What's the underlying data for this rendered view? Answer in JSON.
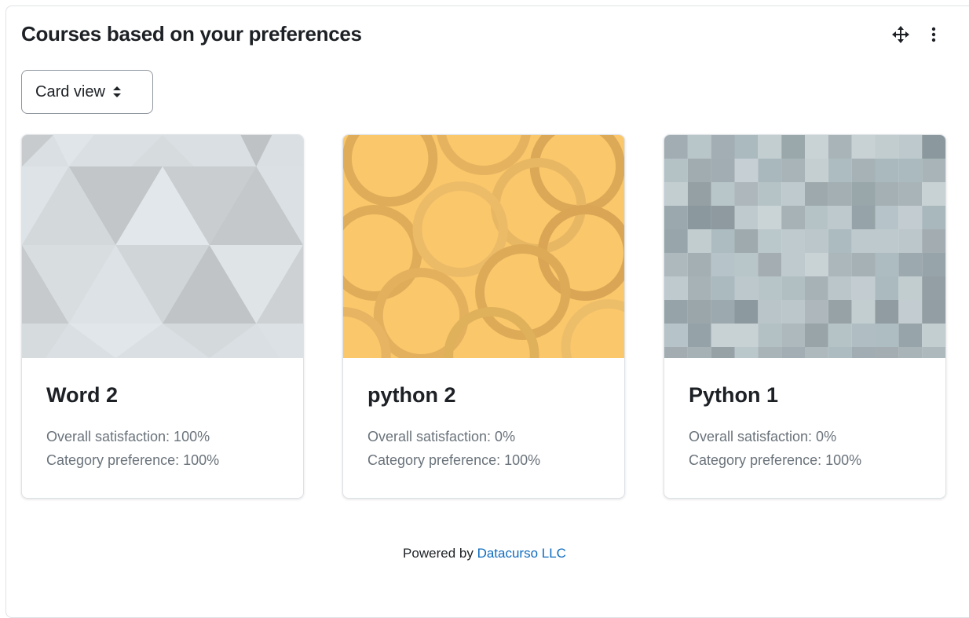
{
  "block": {
    "title": "Courses based on your preferences"
  },
  "controls": {
    "move_icon": "move-arrows-icon",
    "menu_icon": "vertical-ellipsis-icon"
  },
  "view_select": {
    "selected": "Card view"
  },
  "courses": [
    {
      "title": "Word 2",
      "satisfaction": "Overall satisfaction: 100%",
      "preference": "Category preference: 100%",
      "pattern": "triangles",
      "colors": [
        "#dfe5e8",
        "#c9cdd0",
        "#bec2c5",
        "#d4d9dc"
      ]
    },
    {
      "title": "python 2",
      "satisfaction": "Overall satisfaction: 0%",
      "preference": "Category preference: 100%",
      "pattern": "circles",
      "colors": [
        "#fbc76b",
        "#d8a85a",
        "#e6b463"
      ]
    },
    {
      "title": "Python 1",
      "satisfaction": "Overall satisfaction: 0%",
      "preference": "Category preference: 100%",
      "pattern": "squares",
      "colors": [
        "#a8b8bd",
        "#95a3a8",
        "#b9c5c9",
        "#8a979c"
      ]
    }
  ],
  "footer": {
    "prefix": "Powered by",
    "link": "Datacurso LLC"
  },
  "colors": {
    "link": "#0f6cbf",
    "muted_text": "#6a737b",
    "border": "#dee2e6"
  }
}
